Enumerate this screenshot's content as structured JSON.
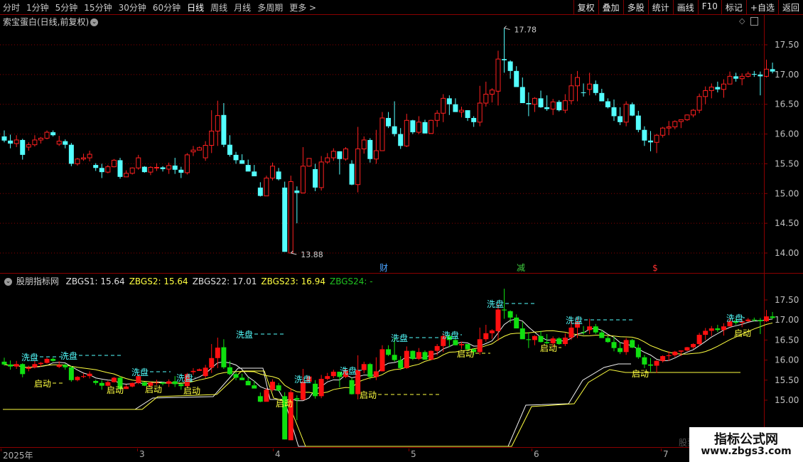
{
  "toolbar": {
    "periods": [
      "分时",
      "1分钟",
      "5分钟",
      "15分钟",
      "30分钟",
      "60分钟",
      "日线",
      "周线",
      "月线",
      "多周期",
      "更多 >"
    ],
    "active_period": "日线",
    "right_buttons": [
      "复权",
      "叠加",
      "多股",
      "统计",
      "画线",
      "F10",
      "标记",
      "+自选",
      "返回"
    ]
  },
  "main_chart": {
    "title": "索宝蛋白(日线,前复权)",
    "price_ticks": [
      "17.50",
      "17.00",
      "16.50",
      "16.00",
      "15.50",
      "15.00",
      "14.50",
      "14.00"
    ],
    "max_label": "17.78",
    "min_label": "13.88",
    "markers": [
      {
        "text": "财",
        "color": "#4aa3ff"
      },
      {
        "text": "减",
        "color": "#40d040"
      },
      {
        "text": "$",
        "color": "#ff3030"
      }
    ]
  },
  "indicator": {
    "name": "股朋指标网",
    "values": [
      {
        "label": "ZBGS1: 15.64",
        "color": "#e0e0e0"
      },
      {
        "label": "ZBGS2: 15.64",
        "color": "#ffff40"
      },
      {
        "label": "ZBGS22: 17.01",
        "color": "#e0e0e0"
      },
      {
        "label": "ZBGS23: 16.94",
        "color": "#ffff40"
      },
      {
        "label": "ZBGS24: -",
        "color": "#20c020"
      }
    ],
    "price_ticks": [
      "17.50",
      "17.00",
      "16.50",
      "16.00",
      "15.50",
      "15.00"
    ],
    "wash_label": "洗盘",
    "start_label": "启动"
  },
  "date_axis": [
    "2025年",
    "3",
    "4",
    "5",
    "6",
    "7"
  ],
  "watermark": {
    "line1": "指标公式网",
    "line2": "www.zbgs3.com",
    "faint": "股票"
  },
  "colors": {
    "up": "#ff2020",
    "down": "#54ffff",
    "ind_up": "#ff1010",
    "ind_down": "#10e010",
    "grid": "#8b0000",
    "cyan": "#54ffff",
    "yellow": "#ffff40"
  },
  "candles": [
    [
      15.96,
      16.06,
      15.86,
      15.89
    ],
    [
      15.89,
      15.99,
      15.76,
      15.84
    ],
    [
      15.84,
      15.98,
      15.78,
      15.9
    ],
    [
      15.9,
      15.92,
      15.57,
      15.65
    ],
    [
      15.78,
      15.86,
      15.72,
      15.82
    ],
    [
      15.82,
      15.98,
      15.79,
      15.9
    ],
    [
      15.9,
      15.95,
      15.84,
      15.93
    ],
    [
      15.93,
      16.06,
      15.91,
      16.03
    ],
    [
      16.03,
      16.06,
      15.96,
      15.98
    ],
    [
      15.83,
      15.97,
      15.8,
      15.88
    ],
    [
      15.88,
      15.91,
      15.76,
      15.82
    ],
    [
      15.82,
      15.85,
      15.46,
      15.5
    ],
    [
      15.5,
      15.6,
      15.47,
      15.58
    ],
    [
      15.58,
      15.67,
      15.55,
      15.6
    ],
    [
      15.6,
      15.72,
      15.54,
      15.66
    ],
    [
      15.48,
      15.51,
      15.38,
      15.43
    ],
    [
      15.43,
      15.5,
      15.26,
      15.36
    ],
    [
      15.36,
      15.48,
      15.34,
      15.45
    ],
    [
      15.45,
      15.58,
      15.44,
      15.56
    ],
    [
      15.56,
      15.6,
      15.25,
      15.28
    ],
    [
      15.28,
      15.39,
      15.28,
      15.34
    ],
    [
      15.34,
      15.44,
      15.32,
      15.43
    ],
    [
      15.43,
      15.65,
      15.4,
      15.6
    ],
    [
      15.45,
      15.46,
      15.35,
      15.36
    ],
    [
      15.36,
      15.46,
      15.31,
      15.44
    ],
    [
      15.44,
      15.51,
      15.38,
      15.44
    ],
    [
      15.44,
      15.46,
      15.37,
      15.41
    ],
    [
      15.41,
      15.52,
      15.33,
      15.47
    ],
    [
      15.47,
      15.6,
      15.33,
      15.4
    ],
    [
      15.4,
      15.45,
      15.26,
      15.35
    ],
    [
      15.35,
      15.68,
      15.32,
      15.65
    ],
    [
      15.7,
      15.8,
      15.63,
      15.73
    ],
    [
      15.73,
      15.79,
      15.73,
      15.77
    ],
    [
      15.6,
      15.88,
      15.55,
      15.81
    ],
    [
      15.81,
      16.4,
      15.68,
      16.05
    ],
    [
      16.05,
      16.56,
      15.8,
      16.31
    ],
    [
      16.32,
      16.52,
      15.78,
      15.82
    ],
    [
      15.82,
      15.98,
      15.62,
      15.65
    ],
    [
      15.65,
      15.7,
      15.5,
      15.56
    ],
    [
      15.56,
      15.66,
      15.5,
      15.5
    ],
    [
      15.48,
      15.57,
      15.46,
      15.37
    ],
    [
      15.37,
      15.48,
      15.3,
      15.29
    ],
    [
      15.1,
      15.19,
      14.95,
      14.96
    ],
    [
      14.96,
      15.3,
      14.97,
      15.26
    ],
    [
      15.26,
      15.52,
      15.22,
      15.46
    ],
    [
      15.37,
      15.43,
      15.22,
      15.24
    ],
    [
      15.1,
      15.2,
      14.02,
      14.02
    ],
    [
      14.0,
      15.3,
      14.0,
      15.2
    ],
    [
      15.05,
      15.12,
      14.5,
      15.01
    ],
    [
      15.01,
      15.78,
      15.0,
      15.46
    ],
    [
      15.46,
      15.59,
      15.45,
      15.59
    ],
    [
      15.41,
      15.5,
      15.04,
      15.1
    ],
    [
      15.1,
      15.63,
      15.05,
      15.53
    ],
    [
      15.53,
      15.68,
      15.5,
      15.6
    ],
    [
      15.6,
      15.76,
      15.55,
      15.71
    ],
    [
      15.71,
      15.71,
      15.32,
      15.58
    ],
    [
      15.58,
      15.78,
      15.55,
      15.75
    ],
    [
      15.5,
      15.56,
      15.14,
      15.15
    ],
    [
      15.15,
      16.12,
      15.02,
      15.75
    ],
    [
      15.75,
      15.96,
      15.67,
      15.9
    ],
    [
      15.9,
      15.93,
      15.52,
      15.58
    ],
    [
      15.58,
      16.07,
      15.5,
      15.72
    ],
    [
      15.72,
      16.37,
      15.72,
      16.27
    ],
    [
      16.27,
      16.37,
      16.1,
      16.13
    ],
    [
      16.13,
      16.55,
      15.96,
      16.0
    ],
    [
      16.0,
      16.1,
      15.75,
      15.8
    ],
    [
      15.8,
      16.34,
      15.78,
      16.23
    ],
    [
      16.23,
      16.24,
      16.0,
      16.03
    ],
    [
      16.03,
      16.3,
      16.0,
      16.2
    ],
    [
      16.2,
      16.24,
      16.01,
      16.01
    ],
    [
      16.01,
      16.24,
      16.0,
      16.23
    ],
    [
      16.23,
      16.4,
      16.12,
      16.35
    ],
    [
      16.35,
      16.67,
      16.2,
      16.6
    ],
    [
      16.6,
      16.65,
      16.32,
      16.5
    ],
    [
      16.5,
      16.6,
      16.37,
      16.37
    ],
    [
      16.37,
      16.46,
      16.28,
      16.4
    ],
    [
      16.4,
      16.4,
      16.22,
      16.27
    ],
    [
      16.27,
      16.3,
      16.12,
      16.2
    ],
    [
      16.2,
      16.81,
      16.13,
      16.52
    ],
    [
      16.52,
      16.88,
      16.46,
      16.67
    ],
    [
      16.67,
      16.77,
      16.53,
      16.74
    ],
    [
      16.72,
      17.4,
      16.48,
      17.26
    ],
    [
      17.26,
      17.78,
      17.03,
      17.24
    ],
    [
      17.22,
      17.24,
      16.93,
      17.06
    ],
    [
      17.06,
      17.14,
      16.8,
      16.79
    ],
    [
      16.79,
      16.95,
      16.56,
      16.52
    ],
    [
      16.52,
      16.7,
      16.3,
      16.5
    ],
    [
      16.5,
      16.62,
      16.37,
      16.6
    ],
    [
      16.6,
      16.73,
      16.44,
      16.45
    ],
    [
      16.45,
      16.65,
      16.39,
      16.42
    ],
    [
      16.42,
      16.59,
      16.32,
      16.54
    ],
    [
      16.54,
      16.57,
      16.38,
      16.4
    ],
    [
      16.4,
      16.67,
      16.35,
      16.56
    ],
    [
      16.56,
      17.01,
      16.5,
      16.81
    ],
    [
      16.81,
      17.06,
      16.55,
      16.95
    ],
    [
      16.7,
      16.85,
      16.63,
      16.69
    ],
    [
      16.75,
      17.03,
      16.65,
      16.84
    ],
    [
      16.84,
      16.9,
      16.65,
      16.69
    ],
    [
      16.69,
      16.76,
      16.55,
      16.55
    ],
    [
      16.55,
      16.6,
      16.43,
      16.45
    ],
    [
      16.45,
      16.58,
      16.22,
      16.3
    ],
    [
      16.3,
      16.45,
      16.15,
      16.2
    ],
    [
      16.2,
      16.55,
      16.13,
      16.5
    ],
    [
      16.5,
      16.53,
      16.3,
      16.31
    ],
    [
      16.31,
      16.39,
      16.03,
      16.07
    ],
    [
      16.07,
      16.13,
      15.8,
      15.89
    ],
    [
      15.89,
      16.05,
      15.71,
      15.86
    ],
    [
      15.86,
      16.0,
      15.68,
      15.98
    ],
    [
      15.98,
      16.12,
      15.94,
      16.1
    ],
    [
      16.1,
      16.22,
      15.98,
      16.12
    ],
    [
      16.12,
      16.23,
      16.08,
      16.21
    ],
    [
      16.21,
      16.24,
      16.1,
      16.24
    ],
    [
      16.24,
      16.33,
      16.22,
      16.32
    ],
    [
      16.32,
      16.42,
      16.28,
      16.4
    ],
    [
      16.4,
      16.68,
      16.35,
      16.63
    ],
    [
      16.63,
      16.8,
      16.5,
      16.73
    ],
    [
      16.73,
      16.85,
      16.6,
      16.79
    ],
    [
      16.79,
      16.88,
      16.7,
      16.75
    ],
    [
      16.75,
      16.92,
      16.61,
      16.84
    ],
    [
      16.84,
      17.05,
      16.84,
      16.97
    ],
    [
      16.97,
      17.03,
      16.88,
      16.93
    ],
    [
      16.93,
      17.02,
      16.82,
      16.97
    ],
    [
      16.97,
      17.05,
      16.95,
      17.01
    ],
    [
      17.01,
      17.06,
      16.96,
      17.0
    ],
    [
      17.0,
      17.05,
      16.65,
      16.97
    ],
    [
      16.97,
      17.25,
      16.95,
      17.09
    ],
    [
      17.09,
      17.2,
      17.02,
      17.05
    ]
  ]
}
